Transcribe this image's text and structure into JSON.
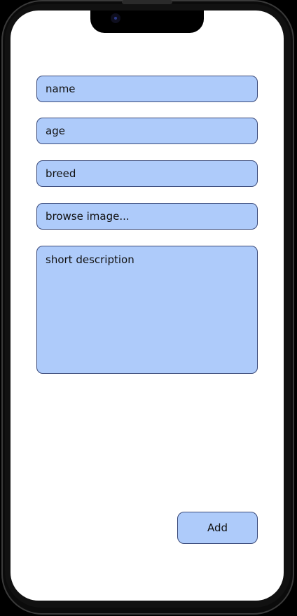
{
  "form": {
    "name_placeholder": "name",
    "age_placeholder": "age",
    "breed_placeholder": "breed",
    "browse_label": "browse image...",
    "description_placeholder": "short description",
    "add_label": "Add"
  },
  "colors": {
    "field_fill": "#aecbfa",
    "field_border": "#3a4a7a",
    "screen_bg": "#ffffff",
    "device_bg": "#000000"
  }
}
